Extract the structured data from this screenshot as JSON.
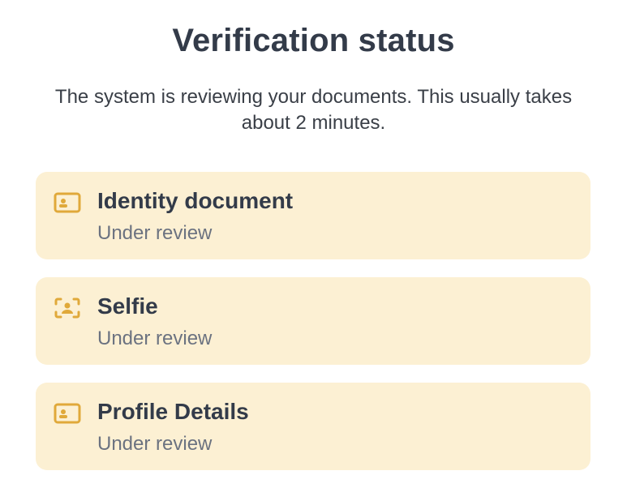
{
  "header": {
    "title": "Verification status",
    "subtitle": "The system is reviewing your documents. This usually takes about 2 minutes."
  },
  "items": [
    {
      "title": "Identity document",
      "status": "Under review",
      "icon": "id-card-icon"
    },
    {
      "title": "Selfie",
      "status": "Under review",
      "icon": "face-scan-icon"
    },
    {
      "title": "Profile Details",
      "status": "Under review",
      "icon": "id-card-icon"
    }
  ],
  "colors": {
    "card_background": "#fcf0d3",
    "icon_accent": "#e0a93a",
    "title_text": "#333b49",
    "status_text": "#6b7280"
  }
}
